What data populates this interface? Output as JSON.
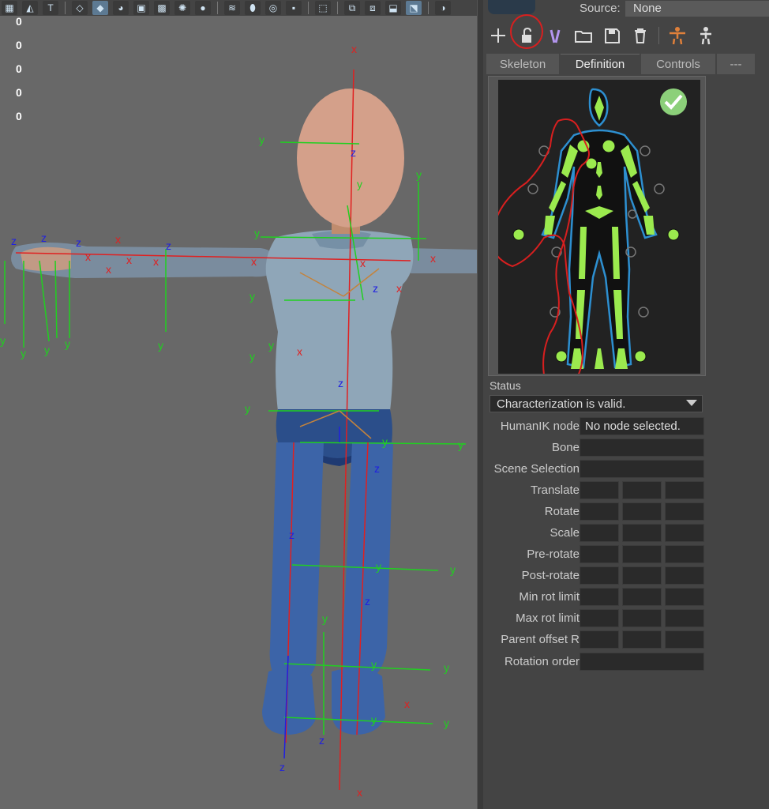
{
  "viewport": {
    "hud_values": [
      "0",
      "0",
      "0",
      "0",
      "0"
    ],
    "toolbar_icons": [
      "wireframe-icon",
      "shaded-cube-icon",
      "texture-icon",
      "lit-cube-icon",
      "checker-icon",
      "light-icon",
      "shadow-icon",
      "layers-icon",
      "material-icon",
      "isolate-icon",
      "grid-icon",
      "select-icon",
      "camera-icon",
      "display-icon",
      "highlight-icon"
    ]
  },
  "panel": {
    "source_label": "Source:",
    "source_value": "None",
    "tabs": [
      "Skeleton",
      "Definition",
      "Controls",
      "---"
    ],
    "active_tab": "Definition",
    "status_label": "Status",
    "status_value": "Characterization is valid.",
    "humanik_node_label": "HumanIK node",
    "humanik_node_value": "No node selected.",
    "properties": {
      "bone": "Bone",
      "scene_selection": "Scene Selection",
      "translate": "Translate",
      "rotate": "Rotate",
      "scale": "Scale",
      "pre_rotate": "Pre-rotate",
      "post_rotate": "Post-rotate",
      "min_rot_limit": "Min rot limit",
      "max_rot_limit": "Max rot limit",
      "parent_offset_r": "Parent offset R",
      "rotation_order": "Rotation order"
    }
  },
  "colors": {
    "valid_green": "#8cd07a",
    "bone_green": "#9bea4e",
    "annotation_red": "#d81f1f",
    "axis_x": "#e02020",
    "axis_y": "#20d020",
    "axis_z": "#2020e0"
  }
}
